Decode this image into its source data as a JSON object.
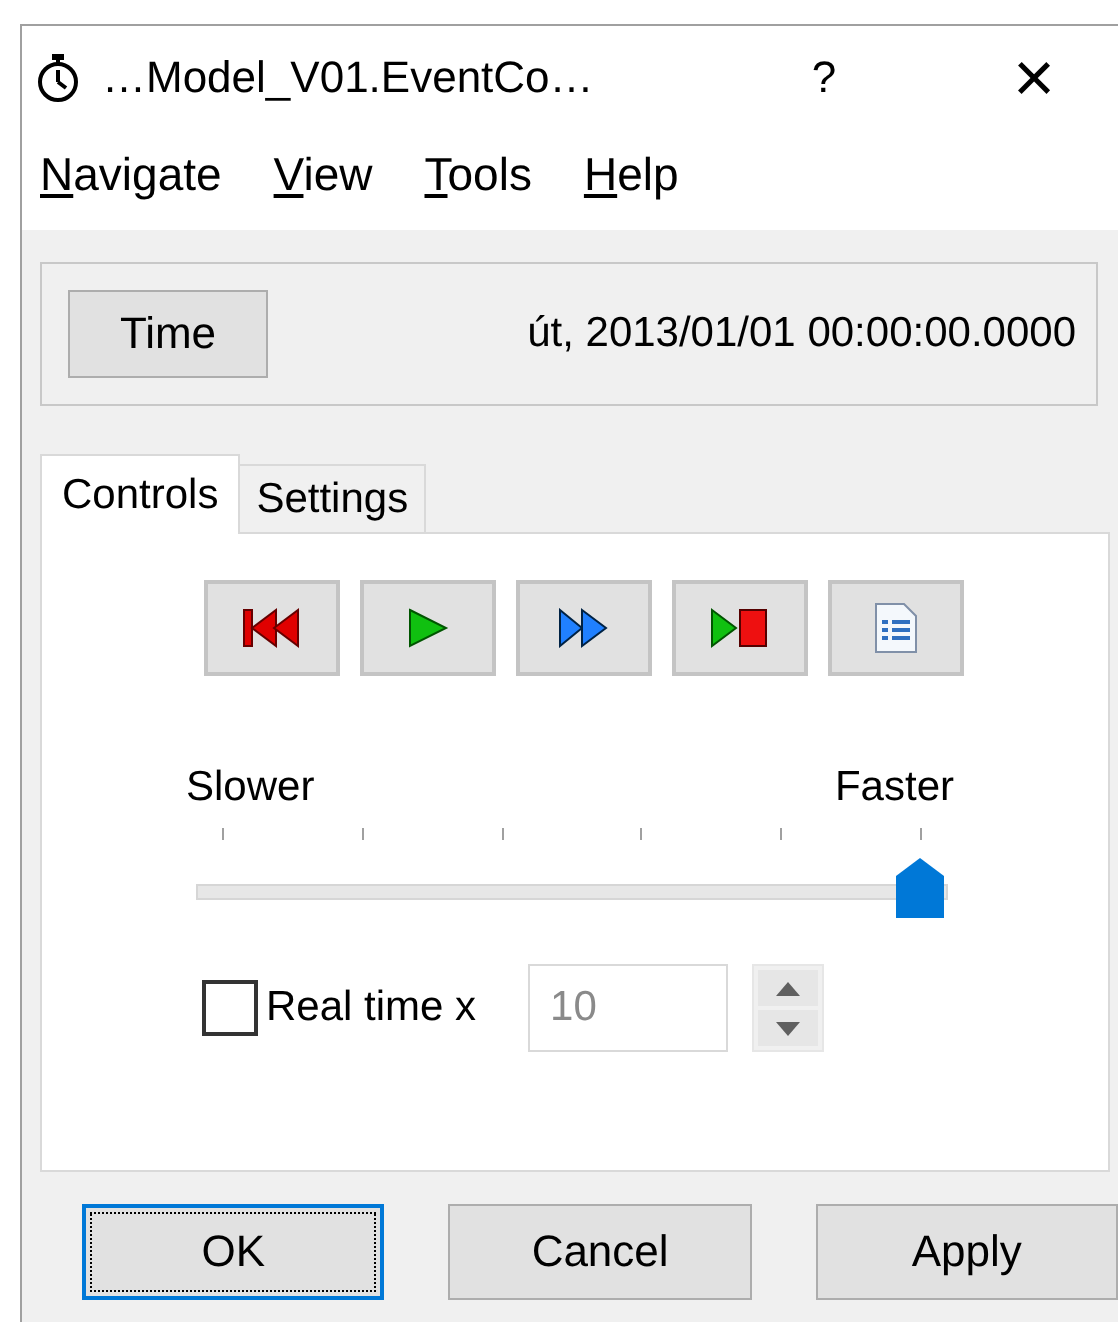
{
  "window": {
    "title": "…Model_V01.EventCo…",
    "help_button": "?",
    "close_button": "×"
  },
  "menu": [
    {
      "label": "Navigate"
    },
    {
      "label": "View"
    },
    {
      "label": "Tools"
    },
    {
      "label": "Help"
    }
  ],
  "time": {
    "button": "Time",
    "value": "út, 2013/01/01 00:00:00.0000"
  },
  "tabs": [
    {
      "label": "Controls",
      "selected": true
    },
    {
      "label": "Settings",
      "selected": false
    }
  ],
  "transport": [
    {
      "kind": "rewind"
    },
    {
      "kind": "play"
    },
    {
      "kind": "fast_forward"
    },
    {
      "kind": "play_stop"
    },
    {
      "kind": "report"
    }
  ],
  "speed": {
    "min_label": "Slower",
    "max_label": "Faster",
    "level": 1.0
  },
  "real_time": {
    "label": "Real time x",
    "checked": false,
    "value": "10",
    "disabled": true
  },
  "buttons": [
    {
      "label": "OK",
      "focused": true
    },
    {
      "label": "Cancel",
      "focused": false
    },
    {
      "label": "Apply",
      "focused": false
    }
  ]
}
